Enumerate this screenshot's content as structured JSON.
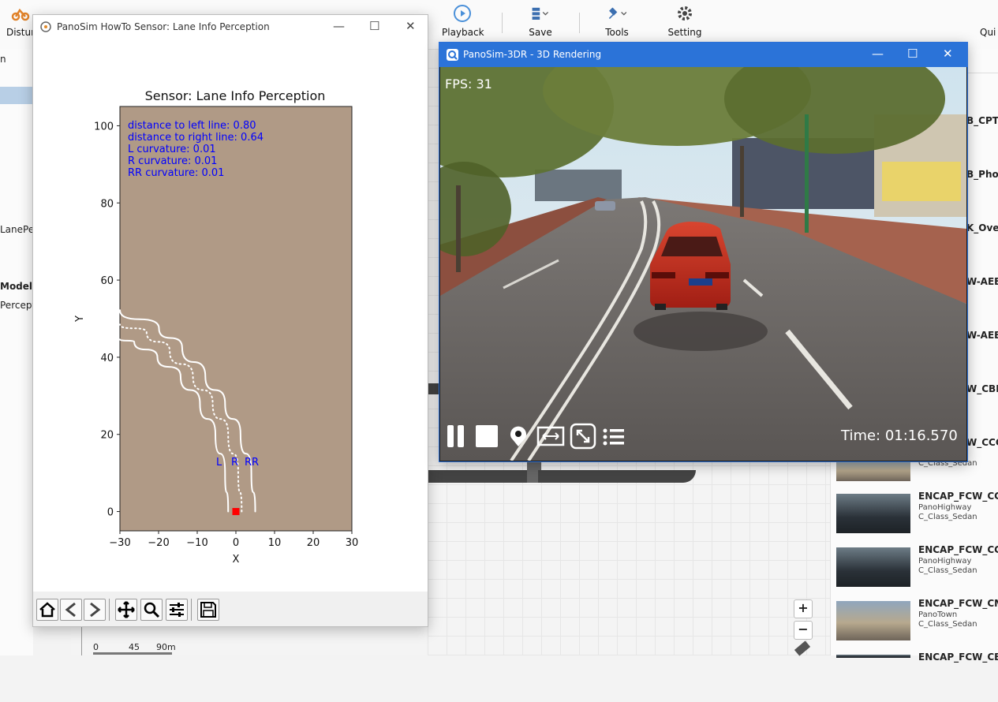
{
  "app": {
    "toolbar": {
      "disturbance_label": "Distur",
      "playback_label": "Playback",
      "save_label": "Save",
      "tools_label": "Tools",
      "setting_label": "Setting",
      "quick_label": "Qui"
    },
    "left_panel": {
      "item_n": "n",
      "item_laneperception": "LanePer",
      "item_model": "Model",
      "item_percept": "Percept"
    },
    "scale": {
      "zero": "0",
      "mid": "45",
      "end": "90m"
    },
    "zoom": {
      "plus": "+",
      "minus": "−"
    },
    "right_list": {
      "truncated": [
        "B_CPTA",
        "B_Phos",
        "K_Over",
        "W-AEB",
        "W-AEB",
        "W_CBL",
        "W_CCC"
      ],
      "items": [
        {
          "name": "",
          "map": "",
          "vehicle": "C_Class_Sedan"
        },
        {
          "name": "ENCAP_FCW_CCR",
          "map": "PanoHighway",
          "vehicle": "C_Class_Sedan"
        },
        {
          "name": "ENCAP_FCW_CCR",
          "map": "PanoHighway",
          "vehicle": "C_Class_Sedan"
        },
        {
          "name": "ENCAP_FCW_CMI",
          "map": "PanoTown",
          "vehicle": "C_Class_Sedan"
        },
        {
          "name": "ENCAP_FCW_CBL",
          "map": "",
          "vehicle": ""
        }
      ]
    }
  },
  "plot_window": {
    "title": "PanoSim HowTo Sensor: Lane Info Perception",
    "plot_title": "Sensor: Lane Info Perception",
    "info_lines": [
      "distance to left line: 0.80",
      "distance to right line: 0.64",
      "L curvature: 0.01",
      "R curvature: 0.01",
      "RR curvature: 0.01"
    ],
    "lane_labels": {
      "l": "L",
      "r": "R",
      "rr": "RR"
    },
    "xlabel": "X",
    "ylabel": "Y",
    "x_ticks": [
      "−30",
      "−20",
      "−10",
      "0",
      "10",
      "20",
      "30"
    ],
    "y_ticks": [
      "0",
      "20",
      "40",
      "60",
      "80",
      "100"
    ],
    "colors": {
      "plot_bg": "#b09a86",
      "text": "#0000ff",
      "lane": "#ffffff",
      "ego": "#ff0000"
    }
  },
  "chart_data": {
    "type": "line",
    "title": "Sensor: Lane Info Perception",
    "xlabel": "X",
    "ylabel": "Y",
    "xlim": [
      -30,
      30
    ],
    "ylim": [
      -5,
      105
    ],
    "grid": false,
    "series": [
      {
        "name": "L",
        "style": "solid",
        "x": [
          -2,
          -2.8,
          -5.3,
          -9.3,
          -14.3,
          -20.3,
          -26.3,
          -30
        ],
        "y": [
          0,
          10,
          20,
          28,
          35,
          40,
          44,
          44.6
        ]
      },
      {
        "name": "R",
        "style": "dotted",
        "x": [
          1.5,
          0.6,
          -2,
          -6,
          -11.1,
          -17.1,
          -23.1,
          -30
        ],
        "y": [
          0,
          10,
          20,
          28,
          35,
          41.5,
          46.5,
          48.5
        ]
      },
      {
        "name": "RR",
        "style": "solid",
        "x": [
          5,
          4,
          1.2,
          -2.8,
          -7.9,
          -13.9,
          -19.9,
          -30
        ],
        "y": [
          0,
          10,
          20,
          28,
          35,
          42.5,
          47.5,
          52.2
        ]
      }
    ],
    "ego": {
      "x": 0,
      "y": 0
    }
  },
  "render_window": {
    "title": "PanoSim-3DR - 3D Rendering",
    "fps": "FPS: 31",
    "time": "Time: 01:16.570"
  }
}
